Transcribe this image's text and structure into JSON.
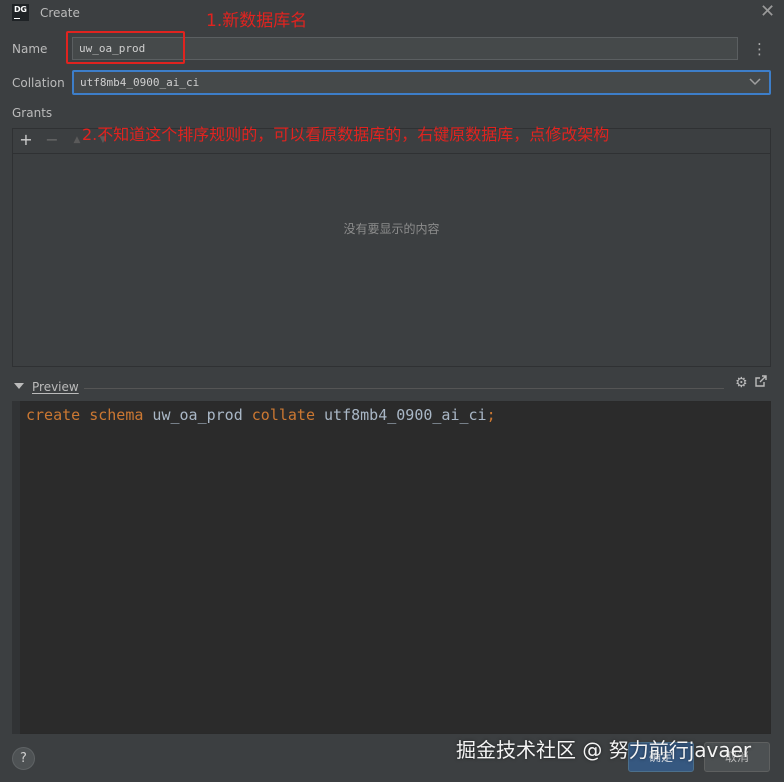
{
  "window": {
    "icon_text": "DG",
    "title": "Create",
    "close_glyph": "✕"
  },
  "form": {
    "name_label": "Name",
    "name_value": "uw_oa_prod",
    "collation_label": "Collation",
    "collation_value": "utf8mb4_0900_ai_ci"
  },
  "grants": {
    "label": "Grants",
    "toolbar": [
      {
        "name": "add",
        "glyph": "+"
      },
      {
        "name": "remove",
        "glyph": "−"
      },
      {
        "name": "move-up",
        "glyph": "▲"
      },
      {
        "name": "move-down",
        "glyph": "▼"
      }
    ],
    "empty_text": "没有要显示的内容"
  },
  "preview": {
    "label": "Preview",
    "code": [
      {
        "t": "create",
        "c": "kw"
      },
      {
        "t": " ",
        "c": "id"
      },
      {
        "t": "schema",
        "c": "kw"
      },
      {
        "t": " uw_oa_prod ",
        "c": "id"
      },
      {
        "t": "collate",
        "c": "kw"
      },
      {
        "t": " utf8mb4_0900_ai_ci",
        "c": "id"
      },
      {
        "t": ";",
        "c": "semi"
      }
    ]
  },
  "buttons": {
    "help": "?",
    "ok": "确定",
    "cancel": "取消"
  },
  "annotations": {
    "note1": "1.新数据库名",
    "note2": "2.不知道这个排序规则的，可以看原数据库的，右键原数据库，点修改架构"
  },
  "watermark": "掘金技术社区 @ 努力前行javaer",
  "colors": {
    "background": "#3c3f41",
    "focus_border": "#3d7ec9",
    "keyword": "#cc7832",
    "identifier": "#a9b7c6",
    "annotation": "#e0231f"
  },
  "icons": [
    "dg-app-icon",
    "close-icon",
    "kebab-menu-icon",
    "chevron-down-icon",
    "add-icon",
    "remove-icon",
    "move-up-icon",
    "move-down-icon",
    "collapse-arrow-icon",
    "settings-gear-icon",
    "open-external-icon",
    "help-icon"
  ]
}
